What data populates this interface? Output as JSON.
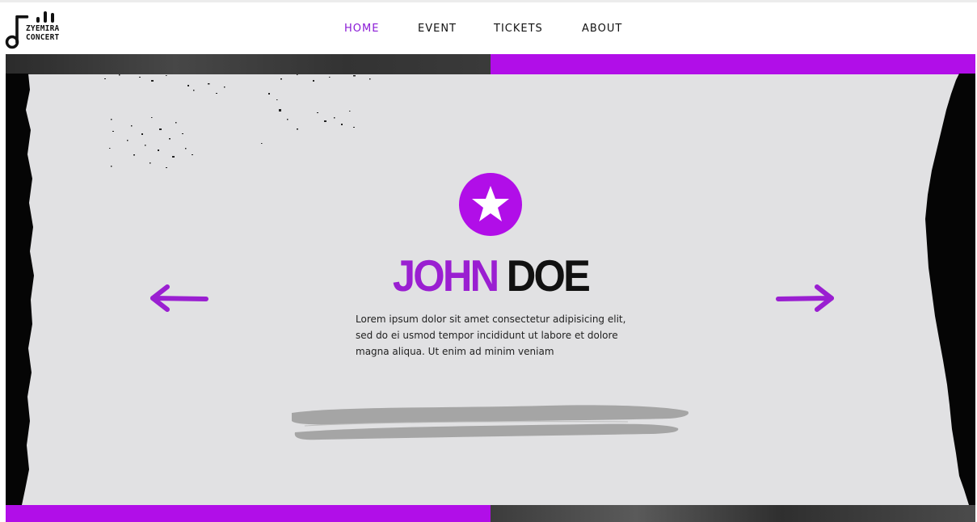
{
  "logo": {
    "line1": "ZYEMIRA",
    "line2": "CONCERT"
  },
  "nav": [
    {
      "label": "HOME",
      "active": true
    },
    {
      "label": "EVENT",
      "active": false
    },
    {
      "label": "TICKETS",
      "active": false
    },
    {
      "label": "ABOUT",
      "active": false
    }
  ],
  "hero": {
    "title_first": "JOHN",
    "title_last": "DOE",
    "description_lines": [
      "Lorem ipsum dolor sit amet consectetur adipisicing elit,",
      "sed do ei usmod tempor incididunt ut labore et dolore",
      "magna aliqua. Ut enim ad minim veniam"
    ],
    "badge_icon": "star-icon",
    "prev_icon": "arrow-left-icon",
    "next_icon": "arrow-right-icon"
  },
  "colors": {
    "accent": "#b10ee8",
    "title_accent": "#9a1fd1",
    "background": "#e1e1e3",
    "dark": "#111111"
  }
}
